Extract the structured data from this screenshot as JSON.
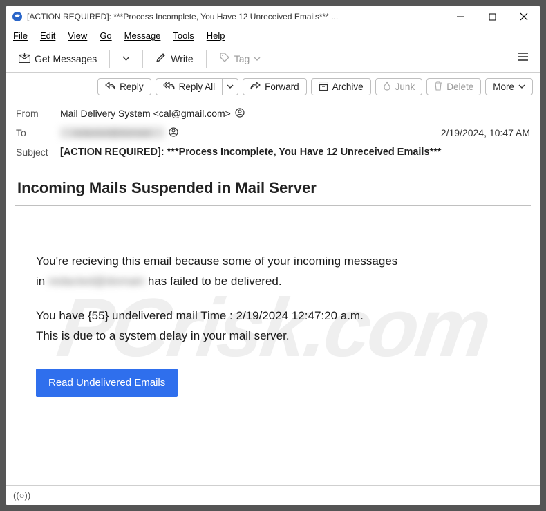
{
  "window": {
    "title": "[ACTION REQUIRED]: ***Process Incomplete, You Have 12 Unreceived Emails*** ..."
  },
  "menu": {
    "file": "File",
    "edit": "Edit",
    "view": "View",
    "go": "Go",
    "message": "Message",
    "tools": "Tools",
    "help": "Help"
  },
  "toolbar": {
    "get_messages": "Get Messages",
    "write": "Write",
    "tag": "Tag"
  },
  "actions": {
    "reply": "Reply",
    "reply_all": "Reply All",
    "forward": "Forward",
    "archive": "Archive",
    "junk": "Junk",
    "delete": "Delete",
    "more": "More"
  },
  "headers": {
    "from_label": "From",
    "from_value": "Mail Delivery System <cal@gmail.com>",
    "to_label": "To",
    "to_value_redacted": "redacted@domain",
    "date": "2/19/2024, 10:47 AM",
    "subject_label": "Subject",
    "subject_value": "[ACTION REQUIRED]: ***Process Incomplete, You Have 12 Unreceived Emails***"
  },
  "body": {
    "heading": "Incoming Mails Suspended in Mail Server",
    "p1a": "You're recieving this email because some of your incoming messages",
    "p1b_prefix": "in ",
    "p1b_redacted": "redacted@domain",
    "p1b_suffix": " has failed to be delivered.",
    "p2": "You have {55} undelivered mail Time : 2/19/2024 12:47:20 a.m.",
    "p3": "This is due to a system delay in your mail server.",
    "cta": "Read Undelivered Emails"
  },
  "status": {
    "icon": "((○))"
  },
  "watermark": "PCrisk.com"
}
